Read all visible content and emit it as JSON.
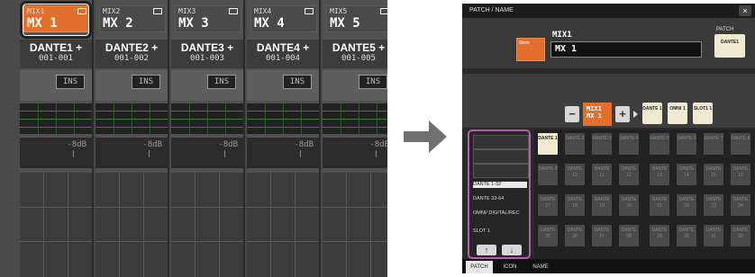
{
  "mixer": {
    "strips": [
      {
        "small": "MIX1",
        "name": "MX 1",
        "patch": "DANTE1 +",
        "patch_sub": "001-001",
        "ins": "INS",
        "level": "-8dB",
        "selected": true
      },
      {
        "small": "MIX2",
        "name": "MX 2",
        "patch": "DANTE2 +",
        "patch_sub": "001-002",
        "ins": "INS",
        "level": "-8dB",
        "selected": false
      },
      {
        "small": "MIX3",
        "name": "MX 3",
        "patch": "DANTE3 +",
        "patch_sub": "001-003",
        "ins": "INS",
        "level": "-8dB",
        "selected": false
      },
      {
        "small": "MIX4",
        "name": "MX 4",
        "patch": "DANTE4 +",
        "patch_sub": "001-004",
        "ins": "INS",
        "level": "-8dB",
        "selected": false
      },
      {
        "small": "MIX5",
        "name": "MX 5",
        "patch": "DANTE5 +",
        "patch_sub": "001-005",
        "ins": "INS",
        "level": "-8dB",
        "selected": false
      }
    ],
    "colors": {
      "selected": "#e2702c",
      "strip": "#515151",
      "eq_grid": "#3d7a3d"
    }
  },
  "patch_window": {
    "title": "PATCH / NAME",
    "close": "×",
    "store_label": "Store",
    "channel_id": "MIX1",
    "name_value": "MX 1",
    "patch_label": "PATCH",
    "patch_button": "DANTE1",
    "channel_button": [
      "MIX1",
      "MX 1"
    ],
    "minus": "−",
    "plus": "+",
    "patch_tags": [
      "DANTE 1",
      "OMNI 1",
      "SLOT1 1"
    ],
    "categories": [
      "DANTE 1-32",
      "DANTE 33-64",
      "OMNI/ DIGITAL/REC",
      "SLOT 1"
    ],
    "selected_category": "DANTE 1-32",
    "scroll_up": "↑",
    "scroll_down": "↓",
    "grid": [
      [
        "DANTE 1",
        "DANTE 2",
        "DANTE 3",
        "DANTE 4",
        "DANTE 5",
        "DANTE 6",
        "DANTE 7",
        "DANTE 8"
      ],
      [
        "DANTE 9",
        "DANTE 10",
        "DANTE 11",
        "DANTE 12",
        "DANTE 13",
        "DANTE 14",
        "DANTE 15",
        "DANTE 16"
      ],
      [
        "DANTE 17",
        "DANTE 18",
        "DANTE 19",
        "DANTE 20",
        "DANTE 21",
        "DANTE 22",
        "DANTE 23",
        "DANTE 24"
      ],
      [
        "DANTE 25",
        "DANTE 26",
        "DANTE 27",
        "DANTE 28",
        "DANTE 29",
        "DANTE 30",
        "DANTE 31",
        "DANTE 32"
      ]
    ],
    "active_cell": "DANTE 1",
    "tabs": [
      "PATCH",
      "ICON",
      "NAME"
    ],
    "active_tab": "PATCH",
    "colors": {
      "accent": "#e2702c",
      "category_border": "#b85eb0",
      "cell_on": "#f1ead2"
    }
  }
}
